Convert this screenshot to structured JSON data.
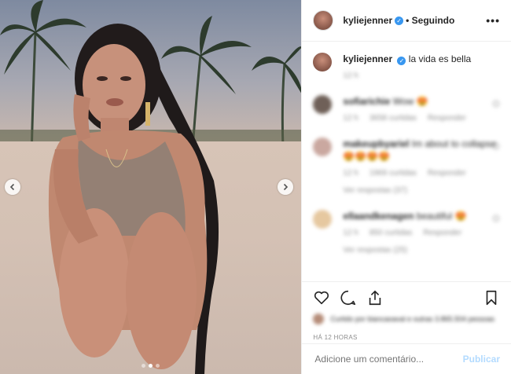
{
  "post": {
    "author": "kyliejenner",
    "follow_status": "• Seguindo",
    "more_label": "•••",
    "caption_author": "kyliejenner",
    "caption_text": "la vida es bella",
    "caption_time": "12 h",
    "comments": [
      {
        "author": "sofiarichie",
        "text": "Wow 😍",
        "time": "12 h",
        "likes": "3658 curtidas",
        "reply": "Responder"
      },
      {
        "author": "makeupbyariel",
        "text": "Im about to collapse 😍😍😍😍",
        "time": "12 h",
        "likes": "1969 curtidas",
        "reply": "Responder",
        "replies": "Ver respostas (37)"
      },
      {
        "author": "ellaandkenagen",
        "text": "beautiful 😍",
        "time": "12 h",
        "likes": "850 curtidas",
        "reply": "Responder",
        "replies": "Ver respostas (25)"
      }
    ],
    "liked_by": "Curtido por biancaoaval e outras 3.865.504 pessoas",
    "timestamp": "HÁ 12 HORAS",
    "comment_placeholder": "Adicione um comentário...",
    "publish_label": "Publicar",
    "carousel": {
      "total_slides": 3,
      "active_slide": 2
    }
  },
  "colors": {
    "link": "#3897f0",
    "publish_disabled": "#b3dbff",
    "meta": "#8e8e8e"
  }
}
